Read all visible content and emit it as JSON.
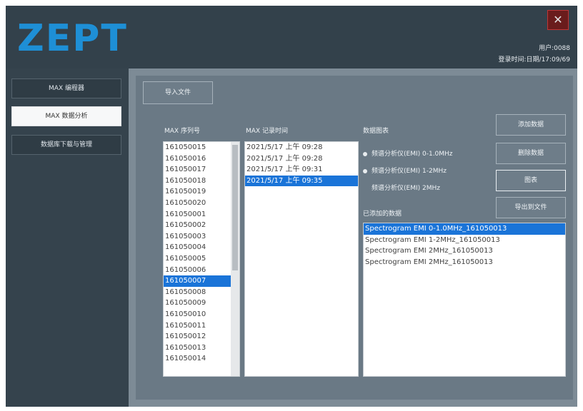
{
  "app": {
    "logo": "ZEPT",
    "close_glyph": "✕"
  },
  "user": {
    "line1": "用户:0088",
    "line2": "登录时间:日期/17:09/69"
  },
  "sidebar": {
    "items": [
      {
        "label": "MAX 编程器"
      },
      {
        "label": "MAX 数据分析"
      },
      {
        "label": "数据库下载与管理"
      }
    ]
  },
  "toolbar": {
    "import_label": "导入文件"
  },
  "columns": {
    "serial_title": "MAX 序列号",
    "record_title": "MAX 记录时间",
    "chart_title": "数据图表",
    "compare_title": "已添加的数据"
  },
  "serials": [
    "161050015",
    "161050016",
    "161050017",
    "161050018",
    "161050019",
    "161050020",
    "161050001",
    "161050002",
    "161050003",
    "161050004",
    "161050005",
    "161050006",
    "161050007",
    "161050008",
    "161050009",
    "161050010",
    "161050011",
    "161050012",
    "161050013",
    "161050014"
  ],
  "selected_serial_index": 12,
  "records": [
    "2021/5/17 上午 09:28",
    "2021/5/17 上午 09:28",
    "2021/5/17 上午 09:31",
    "2021/5/17 上午 09:35"
  ],
  "selected_record_index": 3,
  "radios": [
    {
      "label": "频谱分析仪(EMI) 0-1.0MHz",
      "checked": true
    },
    {
      "label": "频谱分析仪(EMI) 1-2MHz",
      "checked": true
    },
    {
      "label": "频谱分析仪(EMI) 2MHz",
      "checked": false
    }
  ],
  "compare_items": [
    "Spectrogram EMI 0-1.0MHz_161050013",
    "Spectrogram EMI 1-2MHz_161050013",
    "Spectrogram EMI 2MHz_161050013",
    "Spectrogram EMI 2MHz_161050013"
  ],
  "selected_compare_index": 0,
  "actions": {
    "add_label": "添加数据",
    "delete_label": "删除数据",
    "chart_label": "图表",
    "export_label": "导出到文件"
  },
  "colors": {
    "accent": "#1e8fd6",
    "selection": "#1a74d8",
    "close": "#6a1c1c"
  }
}
